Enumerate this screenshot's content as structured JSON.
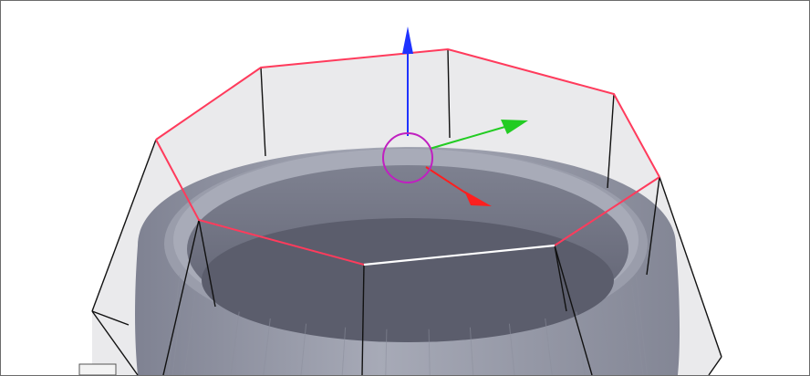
{
  "viewport": {
    "background": "#ffffff",
    "border_color": "#6b6b6b"
  },
  "mesh": {
    "object": "pot-shaped mesh",
    "shade_light": "#c4c7d3",
    "shade_mid": "#9a9dab",
    "shade_dark": "#5f6171",
    "cage_fill": "#d9d9dd",
    "cage_edge": "#111111",
    "selected_edge": "#ff3b5c",
    "active_edge": "#ffffff"
  },
  "gizmo": {
    "x_axis_color": "#ff1f1f",
    "y_axis_color": "#22cc22",
    "z_axis_color": "#1f33ff",
    "center_ring_color": "#c020c0",
    "x_arrow_icon": "x-axis-arrow-icon",
    "y_arrow_icon": "y-axis-arrow-icon",
    "z_arrow_icon": "z-axis-arrow-icon"
  }
}
